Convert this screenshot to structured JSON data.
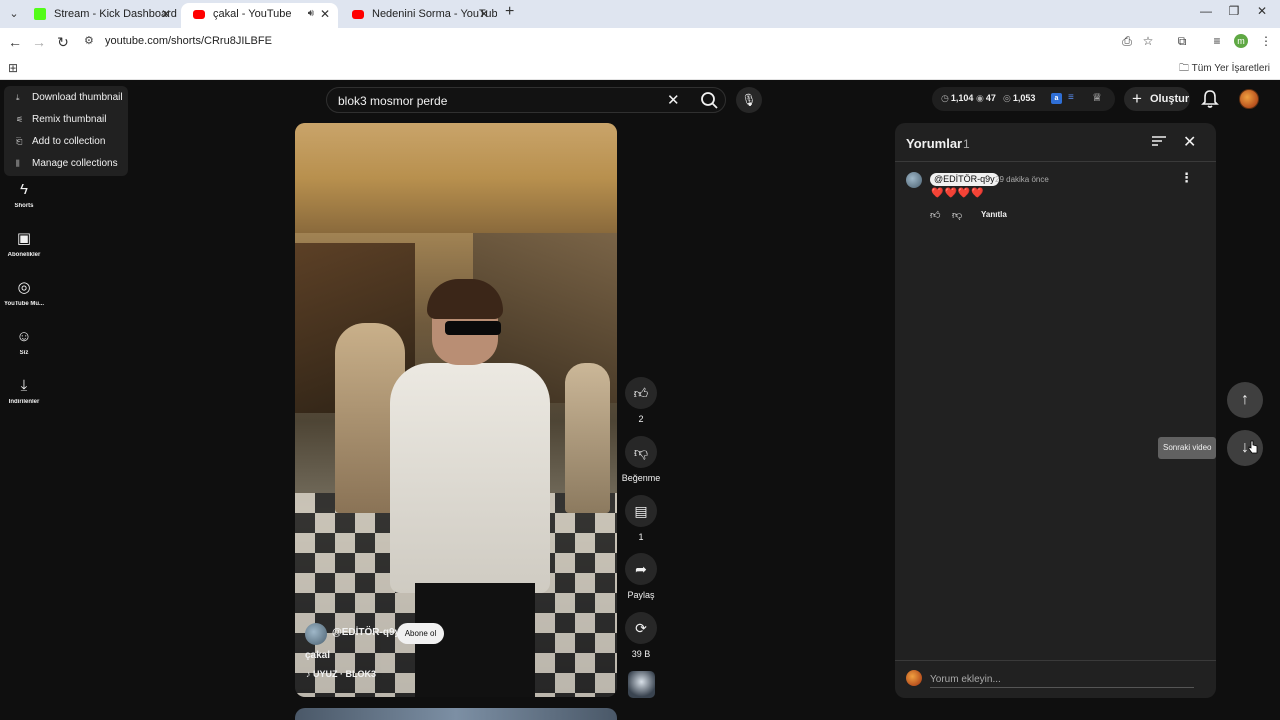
{
  "browser": {
    "tabs": [
      {
        "title": "Stream - Kick Dashboard",
        "favicon_color": "#53fc18"
      },
      {
        "title": "çakal - YouTube",
        "favicon_color": "#ff0000"
      },
      {
        "title": "Nedenini Sorma - YouTube",
        "favicon_color": "#ff0000"
      }
    ],
    "url": "youtube.com/shorts/CRru8JILBFE",
    "bookmarks_all": "Tüm Yer İşaretleri",
    "profile_initial": "m"
  },
  "context_menu": {
    "items": [
      {
        "label": "Download thumbnail",
        "icon": "download-icon"
      },
      {
        "label": "Remix thumbnail",
        "icon": "remix-icon"
      },
      {
        "label": "Add to collection",
        "icon": "collection-add-icon"
      },
      {
        "label": "Manage collections",
        "icon": "collections-icon"
      }
    ]
  },
  "sidebar": {
    "items": [
      {
        "label": "Shorts",
        "icon": "shorts-icon"
      },
      {
        "label": "Abonelikler",
        "icon": "subscriptions-icon"
      },
      {
        "label": "YouTube Mu...",
        "icon": "youtube-music-icon"
      },
      {
        "label": "Siz",
        "icon": "you-icon"
      },
      {
        "label": "İndirilenler",
        "icon": "downloads-icon"
      }
    ]
  },
  "header": {
    "search_value": "blok3 mosmor perde",
    "stats": {
      "views": "1,104",
      "likes": "47",
      "watch": "1,053"
    },
    "create_label": "Oluştur"
  },
  "video": {
    "channel": "@EDİTÖR-q9y",
    "subscribe_label": "Abone ol",
    "title": "çakal",
    "music": "UYUZ · BLOK3"
  },
  "actions": {
    "like_count": "2",
    "dislike_label": "Beğenme",
    "comment_count": "1",
    "share_label": "Paylaş",
    "remix_count": "39 B"
  },
  "comments": {
    "title": "Yorumlar",
    "count": "1",
    "items": [
      {
        "author": "@EDİTÖR-q9y",
        "time": "29 dakika önce",
        "text": "❤️❤️❤️❤️",
        "reply_label": "Yanıtla"
      }
    ],
    "add_placeholder": "Yorum ekleyin..."
  },
  "navigation": {
    "next_tooltip": "Sonraki video"
  }
}
